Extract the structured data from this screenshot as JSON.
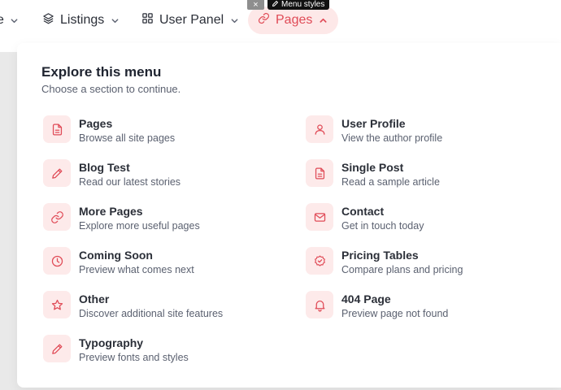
{
  "nav": {
    "partial_label": "e",
    "items": [
      {
        "label": "Listings",
        "icon": "stack-icon"
      },
      {
        "label": "User Panel",
        "icon": "grid-icon"
      },
      {
        "label": "Pages",
        "icon": "link-icon",
        "active": true
      }
    ]
  },
  "editor": {
    "close_label": "×",
    "tag_label": "Menu styles"
  },
  "menu": {
    "title": "Explore this menu",
    "subtitle": "Choose a section to continue.",
    "left": [
      {
        "title": "Pages",
        "desc": "Browse all site pages",
        "icon": "file-icon"
      },
      {
        "title": "Blog Test",
        "desc": "Read our latest stories",
        "icon": "pencil-icon"
      },
      {
        "title": "More Pages",
        "desc": "Explore more useful pages",
        "icon": "link-icon"
      },
      {
        "title": "Coming Soon",
        "desc": "Preview what comes next",
        "icon": "clock-icon"
      },
      {
        "title": "Other",
        "desc": "Discover additional site features",
        "icon": "star-icon"
      },
      {
        "title": "Typography",
        "desc": "Preview fonts and styles",
        "icon": "pencil-icon"
      }
    ],
    "right": [
      {
        "title": "User Profile",
        "desc": "View the author profile",
        "icon": "user-icon"
      },
      {
        "title": "Single Post",
        "desc": "Read a sample article",
        "icon": "file-icon"
      },
      {
        "title": "Contact",
        "desc": "Get in touch today",
        "icon": "mail-icon"
      },
      {
        "title": "Pricing Tables",
        "desc": "Compare plans and pricing",
        "icon": "badge-check-icon"
      },
      {
        "title": "404 Page",
        "desc": "Preview page not found",
        "icon": "bell-icon"
      }
    ]
  },
  "colors": {
    "accent": "#e04b57",
    "accent_bg": "#fdeaea",
    "text": "#2b2f38",
    "muted": "#5b6170"
  }
}
